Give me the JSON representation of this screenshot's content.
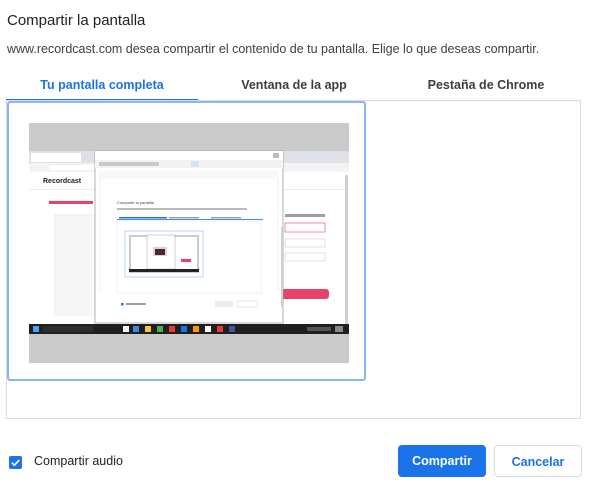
{
  "dialog": {
    "title": "Compartir la pantalla",
    "description": "www.recordcast.com desea compartir el contenido de tu pantalla. Elige lo que deseas compartir."
  },
  "tabs": [
    {
      "label": "Tu pantalla completa",
      "active": true
    },
    {
      "label": "Ventana de la app",
      "active": false
    },
    {
      "label": "Pestaña de Chrome",
      "active": false
    }
  ],
  "preview": {
    "app_logo": "Recordcast",
    "inner_dialog_title": "Compartir la pantalla",
    "inner_tabs": [
      "Tu pantalla completa",
      "Ventana de la app",
      "Pestaña de Chrome"
    ]
  },
  "footer": {
    "audio_label": "Compartir audio",
    "audio_checked": true,
    "share_label": "Compartir",
    "cancel_label": "Cancelar"
  },
  "colors": {
    "accent": "#1a73e8",
    "selection_border": "#8ab4f8",
    "preview_pink": "#e8426b"
  }
}
